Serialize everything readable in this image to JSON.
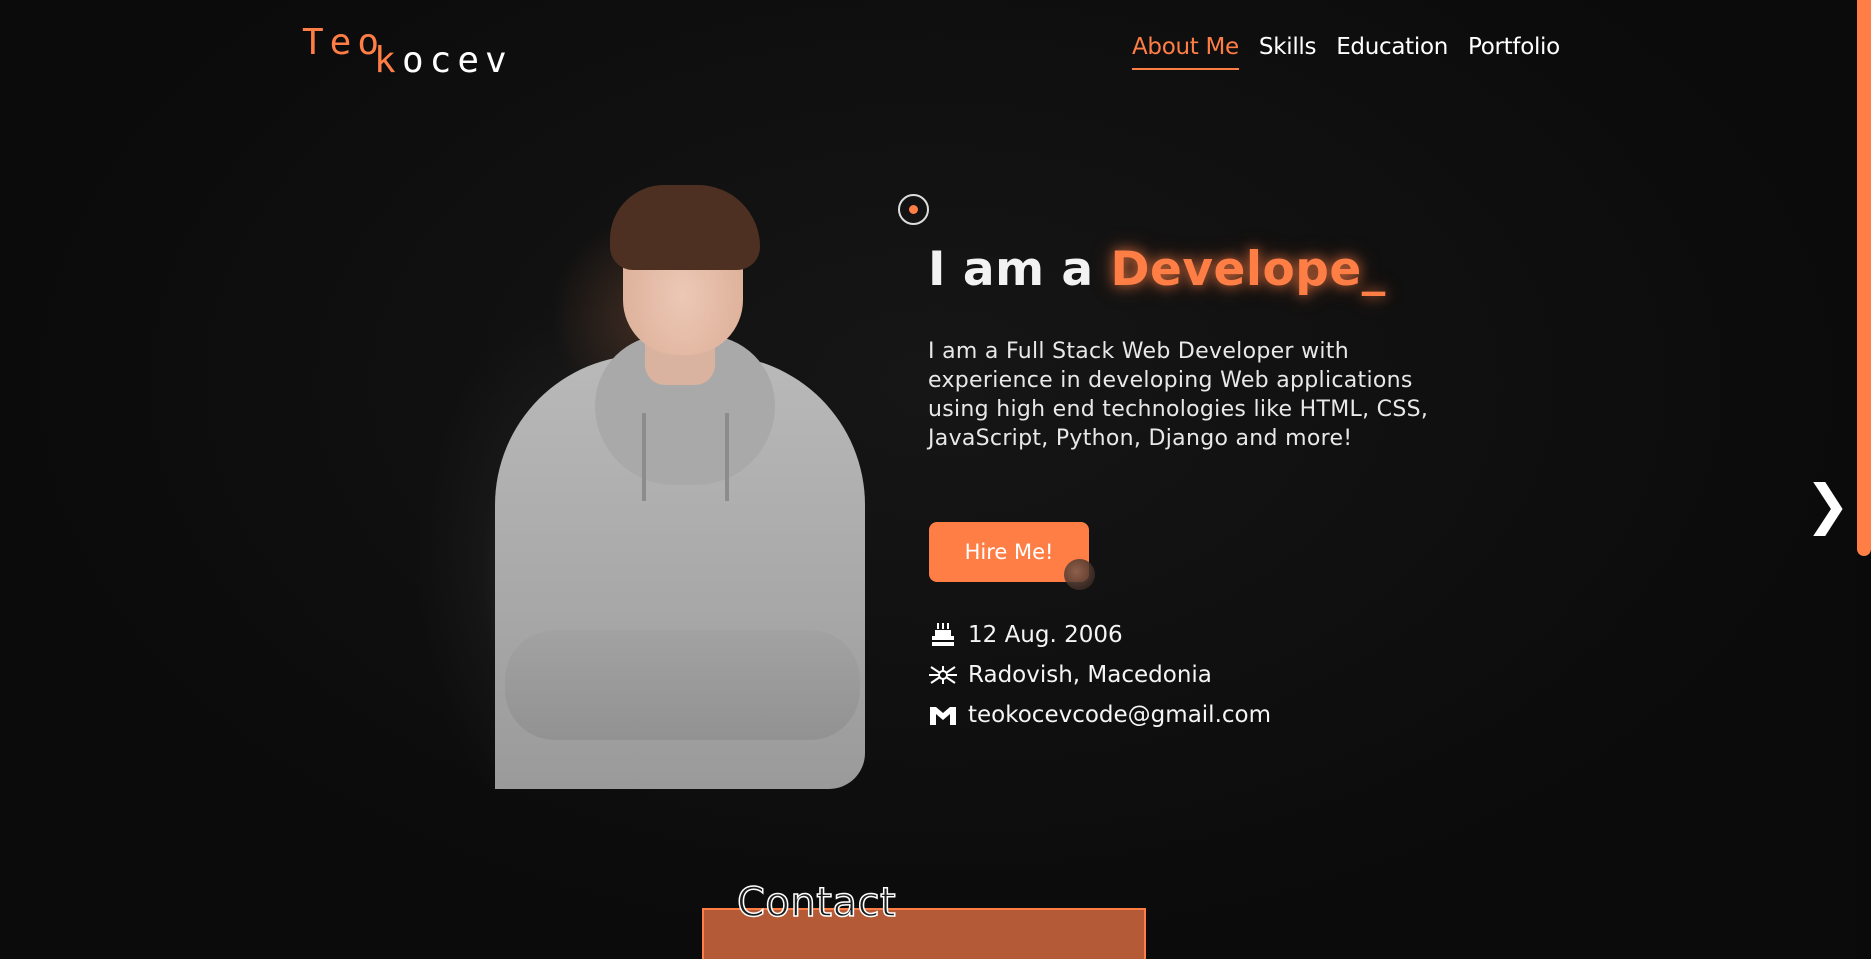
{
  "logo": {
    "part1": "Teo",
    "part2": "k",
    "part3": "ocev"
  },
  "nav": {
    "items": [
      {
        "label": "About Me",
        "active": true
      },
      {
        "label": "Skills",
        "active": false
      },
      {
        "label": "Education",
        "active": false
      },
      {
        "label": "Portfolio",
        "active": false
      }
    ]
  },
  "hero": {
    "headline_prefix": "I am a ",
    "headline_accent": "Develope_",
    "intro": "I am a Full Stack Web Developer with experience in developing Web applications using high end technologies like HTML, CSS, JavaScript, Python, Django and more!",
    "cta_label": "Hire Me!"
  },
  "info": {
    "birthday": "12 Aug. 2006",
    "location": "Radovish, Macedonia",
    "email": "teokocevcode@gmail.com"
  },
  "icons": {
    "birthday": "cake-icon",
    "location": "macedonia-flag-icon",
    "email": "gmail-icon",
    "next": "chevron-right-icon",
    "target": "target-icon"
  },
  "contact": {
    "title": "Contact"
  },
  "colors": {
    "accent": "#ff7e45",
    "background": "#0d0d0d",
    "text": "#ffffff"
  }
}
